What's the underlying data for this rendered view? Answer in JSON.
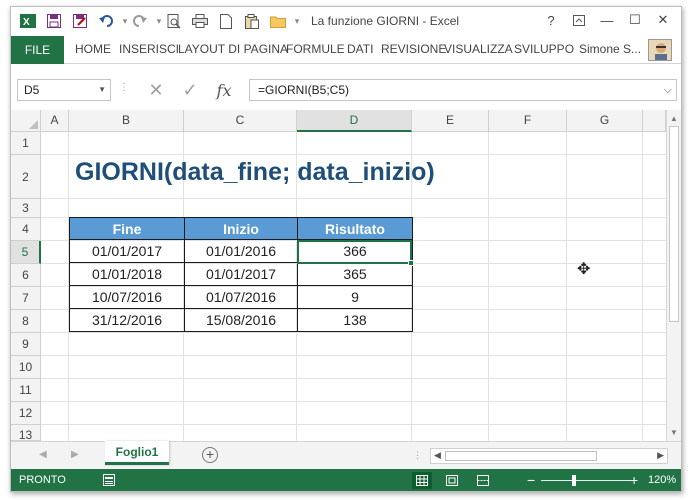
{
  "window": {
    "title": "La funzione GIORNI - Excel",
    "help": "?",
    "restore": "🗗",
    "minimize": "—",
    "maximize": "☐",
    "close": "✕"
  },
  "ribbon": {
    "file": "FILE",
    "tabs": [
      "HOME",
      "INSERISCI",
      "LAYOUT DI PAGINA",
      "FORMULE",
      "DATI",
      "REVISIONE",
      "VISUALIZZA",
      "SVILUPPO"
    ],
    "user": "Simone S..."
  },
  "formula_bar": {
    "name_box": "D5",
    "formula": "=GIORNI(B5;C5)",
    "fx": "fx",
    "cancel": "✕",
    "enter": "✓"
  },
  "columns": [
    "A",
    "B",
    "C",
    "D",
    "E",
    "F",
    "G"
  ],
  "selected_column": "D",
  "rows": [
    "1",
    "2",
    "3",
    "4",
    "5",
    "6",
    "7",
    "8",
    "9",
    "10",
    "11",
    "12",
    "13"
  ],
  "selected_row": "5",
  "sheet": {
    "title": "GIORNI(data_fine; data_inizio)",
    "headers": [
      "Fine",
      "Inizio",
      "Risultato"
    ],
    "rows": [
      [
        "01/01/2017",
        "01/01/2016",
        "366"
      ],
      [
        "01/01/2018",
        "01/01/2017",
        "365"
      ],
      [
        "10/07/2016",
        "01/07/2016",
        "9"
      ],
      [
        "31/12/2016",
        "15/08/2016",
        "138"
      ]
    ],
    "header_color": "#5b9bd5",
    "title_color": "#1f4e79"
  },
  "sheet_tabs": {
    "active": "Foglio1",
    "add": "+"
  },
  "status": {
    "text": "PRONTO",
    "zoom": "120%",
    "zoom_minus": "−",
    "zoom_plus": "+",
    "accent": "#217346"
  }
}
